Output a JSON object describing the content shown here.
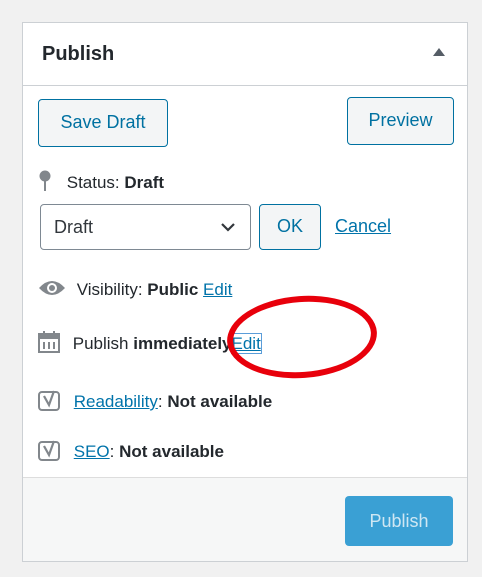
{
  "header": {
    "title": "Publish",
    "toggle_icon": "triangle-up-icon"
  },
  "actions": {
    "save_draft": "Save Draft",
    "preview": "Preview"
  },
  "status": {
    "label": "Status:",
    "value": "Draft"
  },
  "status_editor": {
    "selected": "Draft",
    "ok": "OK",
    "cancel": "Cancel"
  },
  "visibility": {
    "label": "Visibility:",
    "value": "Public",
    "edit": "Edit"
  },
  "schedule": {
    "label": "Publish",
    "value": "immediately",
    "edit": "Edit"
  },
  "readability": {
    "link": "Readability",
    "sep": ":",
    "value": "Not available"
  },
  "seo": {
    "link": "SEO",
    "sep": ":",
    "value": "Not available"
  },
  "footer": {
    "publish": "Publish"
  },
  "colors": {
    "accent": "#0071a1",
    "link": "#0073aa",
    "annotation": "#e8000b",
    "publish_button": "#3aa0d4"
  }
}
